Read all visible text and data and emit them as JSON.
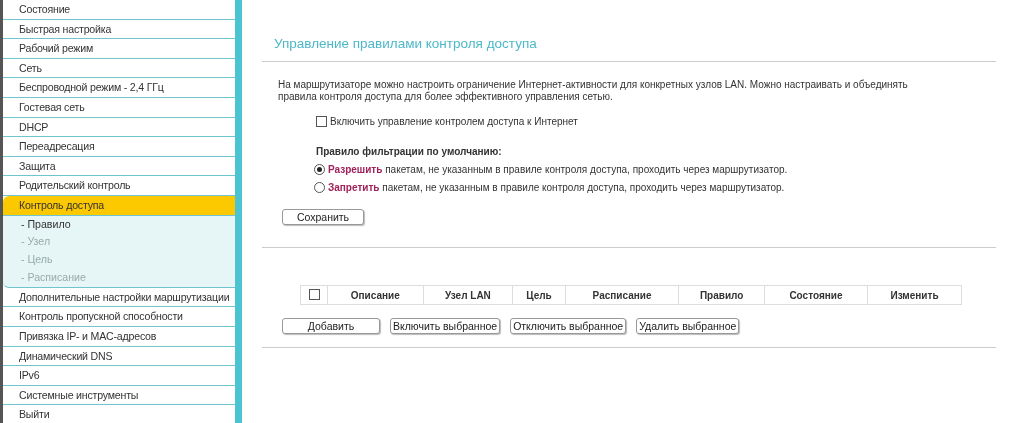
{
  "sidebar": {
    "items": [
      {
        "label": "Состояние",
        "selected": false
      },
      {
        "label": "Быстрая настройка",
        "selected": false
      },
      {
        "label": "Рабочий режим",
        "selected": false
      },
      {
        "label": "Сеть",
        "selected": false
      },
      {
        "label": "Беспроводной режим - 2,4 ГГц",
        "selected": false
      },
      {
        "label": "Гостевая сеть",
        "selected": false
      },
      {
        "label": "DHCP",
        "selected": false
      },
      {
        "label": "Переадресация",
        "selected": false
      },
      {
        "label": "Защита",
        "selected": false
      },
      {
        "label": "Родительский контроль",
        "selected": false
      },
      {
        "label": "Контроль доступа",
        "selected": true,
        "children": [
          {
            "label": "- Правило",
            "selected": true
          },
          {
            "label": "- Узел",
            "selected": false
          },
          {
            "label": "- Цель",
            "selected": false
          },
          {
            "label": "- Расписание",
            "selected": false
          }
        ]
      },
      {
        "label": "Дополнительные настройки маршрутизации",
        "selected": false
      },
      {
        "label": "Контроль пропускной способности",
        "selected": false
      },
      {
        "label": "Привязка IP- и MAC-адресов",
        "selected": false
      },
      {
        "label": "Динамический DNS",
        "selected": false
      },
      {
        "label": "IPv6",
        "selected": false
      },
      {
        "label": "Системные инструменты",
        "selected": false
      },
      {
        "label": "Выйти",
        "selected": false
      }
    ]
  },
  "title": "Управление правилами контроля доступа",
  "description": "На маршрутизаторе можно настроить ограничение Интернет-активности для конкретных узлов LAN. Можно настраивать и объединять правила контроля доступа для более эффективного управления сетью.",
  "enable_checkbox": {
    "label": "Включить управление контролем доступа к Интернет",
    "checked": false
  },
  "filter_label": "Правило фильтрации по умолчанию:",
  "filter_options": [
    {
      "label": "**Разрешить** пакетам, не указанным в правиле контроля доступа, проходить через маршрутизатор.",
      "selected": true
    },
    {
      "label": "**Запретить** пакетам, не указанным в правиле контроля доступа, проходить через маршрутизатор.",
      "selected": false
    }
  ],
  "save_button": "Сохранить",
  "table": {
    "select_all_checked": false,
    "columns": [
      "Описание",
      "Узел LAN",
      "Цель",
      "Расписание",
      "Правило",
      "Состояние",
      "Изменить"
    ]
  },
  "table_buttons": [
    "Добавить",
    "Включить выбранное",
    "Отключить выбранное",
    "Удалить выбранное"
  ]
}
